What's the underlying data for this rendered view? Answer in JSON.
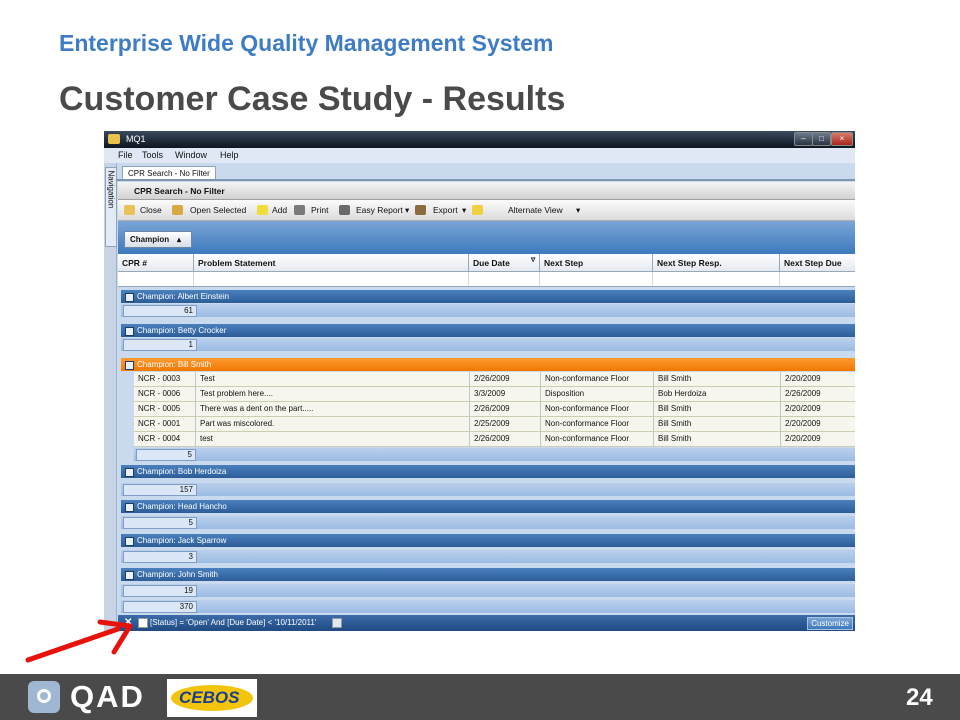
{
  "slide": {
    "subtitle": "Enterprise Wide Quality Management System",
    "title": "Customer Case Study - Results",
    "page_number": "24",
    "logos": {
      "qad": "QAD",
      "cebos": "CEBOS"
    }
  },
  "app": {
    "window_title": "MQ1",
    "menu": [
      "File",
      "Tools",
      "Window",
      "Help"
    ],
    "nav_label": "Navigation",
    "doc_tab": "CPR Search - No Filter",
    "panel_title": "CPR Search - No Filter",
    "toolbar": [
      {
        "label": "Close",
        "icon": "folder-icon"
      },
      {
        "label": "Open Selected",
        "icon": "open-folder-icon"
      },
      {
        "label": "Add",
        "icon": "star-icon"
      },
      {
        "label": "Print",
        "icon": "printer-icon"
      },
      {
        "label": "Easy Report",
        "icon": "report-icon"
      },
      {
        "label": "Export",
        "icon": "export-icon"
      },
      {
        "label": "Alternate View",
        "icon": "view-icon"
      }
    ],
    "group_by": "Champion",
    "columns": [
      "CPR #",
      "Problem Statement",
      "Due Date",
      "Next Step",
      "Next Step Resp.",
      "Next Step Due"
    ],
    "groups": [
      {
        "label": "Champion: Albert Einstein",
        "count": "61",
        "expanded": false,
        "rows": []
      },
      {
        "label": "Champion: Betty Crocker",
        "count": "1",
        "expanded": false,
        "rows": []
      },
      {
        "label": "Champion: Bill Smith",
        "count": "5",
        "expanded": true,
        "rows": [
          {
            "cpr": "NCR - 0003",
            "problem": "Test",
            "due": "2/26/2009",
            "next_step": "Non-conformance Floor",
            "resp": "Bill Smith",
            "next_due": "2/20/2009"
          },
          {
            "cpr": "NCR - 0006",
            "problem": "Test problem here....",
            "due": "3/3/2009",
            "next_step": "Disposition",
            "resp": "Bob Herdoiza",
            "next_due": "2/26/2009"
          },
          {
            "cpr": "NCR - 0005",
            "problem": "There was a dent on the part.....",
            "due": "2/26/2009",
            "next_step": "Non-conformance Floor",
            "resp": "Bill Smith",
            "next_due": "2/20/2009"
          },
          {
            "cpr": "NCR - 0001",
            "problem": "Part was miscolored.",
            "due": "2/25/2009",
            "next_step": "Non-conformance Floor",
            "resp": "Bill Smith",
            "next_due": "2/20/2009"
          },
          {
            "cpr": "NCR - 0004",
            "problem": "test",
            "due": "2/26/2009",
            "next_step": "Non-conformance Floor",
            "resp": "Bill Smith",
            "next_due": "2/20/2009"
          }
        ]
      },
      {
        "label": "Champion: Bob Herdoiza",
        "count": "157",
        "expanded": false,
        "rows": []
      },
      {
        "label": "Champion: Head Hancho",
        "count": "5",
        "expanded": false,
        "rows": []
      },
      {
        "label": "Champion: Jack Sparrow",
        "count": "3",
        "expanded": false,
        "rows": []
      },
      {
        "label": "Champion: John Smith",
        "count": "19",
        "expanded": false,
        "rows": []
      }
    ],
    "grand_total": "370",
    "filter_text": "[Status] = 'Open' And [Due Date] < '10/11/2011'",
    "customize_label": "Customize"
  }
}
